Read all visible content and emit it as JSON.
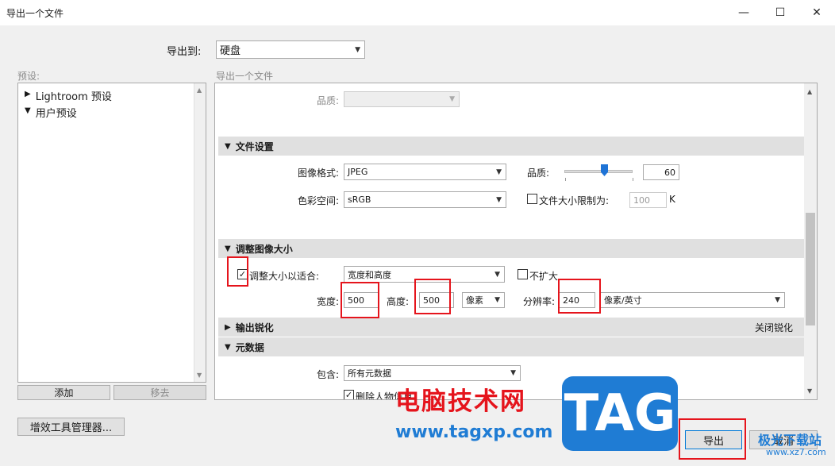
{
  "window": {
    "title": "导出一个文件",
    "minimize": "—",
    "maximize": "☐",
    "close": "✕"
  },
  "export_to": {
    "label": "导出到:",
    "value": "硬盘"
  },
  "presets": {
    "label": "预设:",
    "items": [
      {
        "arrow": "▶",
        "label": "Lightroom 预设"
      },
      {
        "arrow": "▼",
        "label": "用户预设"
      }
    ],
    "add": "添加",
    "remove": "移去"
  },
  "plugin_manager": "增效工具管理器...",
  "export_panel_label": "导出一个文件",
  "quality_top": {
    "label": "品质:"
  },
  "file_settings": {
    "title": "文件设置",
    "format_label": "图像格式:",
    "format_value": "JPEG",
    "quality_label": "品质:",
    "quality_value": "60",
    "quality_level": 0.6,
    "colorspace_label": "色彩空间:",
    "colorspace_value": "sRGB",
    "limit_label": "文件大小限制为:",
    "limit_value": "100",
    "limit_unit": "K"
  },
  "resize": {
    "title": "调整图像大小",
    "fit_label": "调整大小以适合:",
    "fit_checked": "✓",
    "fit_value": "宽度和高度",
    "no_enlarge": "不扩大",
    "width_label": "宽度:",
    "width_value": "500",
    "height_label": "高度:",
    "height_value": "500",
    "unit_value": "像素",
    "resolution_label": "分辨率:",
    "resolution_value": "240",
    "resolution_unit": "像素/英寸"
  },
  "sharpen": {
    "title": "输出锐化",
    "status": "关闭锐化"
  },
  "metadata": {
    "title": "元数据",
    "include_label": "包含:",
    "include_value": "所有元数据",
    "remove_person": "删除人物信息",
    "remove_person_checked": "✓"
  },
  "buttons": {
    "export": "导出",
    "cancel": "取消"
  },
  "watermark": {
    "site": "电脑技术网",
    "url": "www.tagxp.com",
    "tag": "TAG",
    "brand": "极光下载站",
    "brand_url": "www.xz7.com"
  },
  "colors": {
    "red": "#e5141c",
    "tag_blue": "#1f7cd4"
  }
}
